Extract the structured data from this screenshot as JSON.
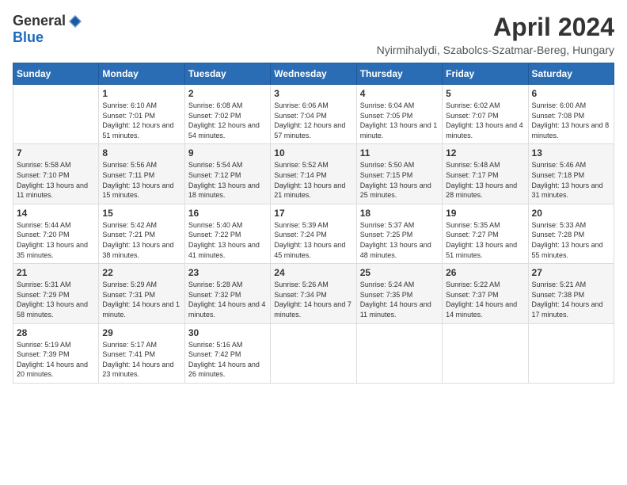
{
  "logo": {
    "general": "General",
    "blue": "Blue"
  },
  "header": {
    "title": "April 2024",
    "location": "Nyirmihalydi, Szabolcs-Szatmar-Bereg, Hungary"
  },
  "weekdays": [
    "Sunday",
    "Monday",
    "Tuesday",
    "Wednesday",
    "Thursday",
    "Friday",
    "Saturday"
  ],
  "weeks": [
    [
      {
        "day": "",
        "sunrise": "",
        "sunset": "",
        "daylight": ""
      },
      {
        "day": "1",
        "sunrise": "Sunrise: 6:10 AM",
        "sunset": "Sunset: 7:01 PM",
        "daylight": "Daylight: 12 hours and 51 minutes."
      },
      {
        "day": "2",
        "sunrise": "Sunrise: 6:08 AM",
        "sunset": "Sunset: 7:02 PM",
        "daylight": "Daylight: 12 hours and 54 minutes."
      },
      {
        "day": "3",
        "sunrise": "Sunrise: 6:06 AM",
        "sunset": "Sunset: 7:04 PM",
        "daylight": "Daylight: 12 hours and 57 minutes."
      },
      {
        "day": "4",
        "sunrise": "Sunrise: 6:04 AM",
        "sunset": "Sunset: 7:05 PM",
        "daylight": "Daylight: 13 hours and 1 minute."
      },
      {
        "day": "5",
        "sunrise": "Sunrise: 6:02 AM",
        "sunset": "Sunset: 7:07 PM",
        "daylight": "Daylight: 13 hours and 4 minutes."
      },
      {
        "day": "6",
        "sunrise": "Sunrise: 6:00 AM",
        "sunset": "Sunset: 7:08 PM",
        "daylight": "Daylight: 13 hours and 8 minutes."
      }
    ],
    [
      {
        "day": "7",
        "sunrise": "Sunrise: 5:58 AM",
        "sunset": "Sunset: 7:10 PM",
        "daylight": "Daylight: 13 hours and 11 minutes."
      },
      {
        "day": "8",
        "sunrise": "Sunrise: 5:56 AM",
        "sunset": "Sunset: 7:11 PM",
        "daylight": "Daylight: 13 hours and 15 minutes."
      },
      {
        "day": "9",
        "sunrise": "Sunrise: 5:54 AM",
        "sunset": "Sunset: 7:12 PM",
        "daylight": "Daylight: 13 hours and 18 minutes."
      },
      {
        "day": "10",
        "sunrise": "Sunrise: 5:52 AM",
        "sunset": "Sunset: 7:14 PM",
        "daylight": "Daylight: 13 hours and 21 minutes."
      },
      {
        "day": "11",
        "sunrise": "Sunrise: 5:50 AM",
        "sunset": "Sunset: 7:15 PM",
        "daylight": "Daylight: 13 hours and 25 minutes."
      },
      {
        "day": "12",
        "sunrise": "Sunrise: 5:48 AM",
        "sunset": "Sunset: 7:17 PM",
        "daylight": "Daylight: 13 hours and 28 minutes."
      },
      {
        "day": "13",
        "sunrise": "Sunrise: 5:46 AM",
        "sunset": "Sunset: 7:18 PM",
        "daylight": "Daylight: 13 hours and 31 minutes."
      }
    ],
    [
      {
        "day": "14",
        "sunrise": "Sunrise: 5:44 AM",
        "sunset": "Sunset: 7:20 PM",
        "daylight": "Daylight: 13 hours and 35 minutes."
      },
      {
        "day": "15",
        "sunrise": "Sunrise: 5:42 AM",
        "sunset": "Sunset: 7:21 PM",
        "daylight": "Daylight: 13 hours and 38 minutes."
      },
      {
        "day": "16",
        "sunrise": "Sunrise: 5:40 AM",
        "sunset": "Sunset: 7:22 PM",
        "daylight": "Daylight: 13 hours and 41 minutes."
      },
      {
        "day": "17",
        "sunrise": "Sunrise: 5:39 AM",
        "sunset": "Sunset: 7:24 PM",
        "daylight": "Daylight: 13 hours and 45 minutes."
      },
      {
        "day": "18",
        "sunrise": "Sunrise: 5:37 AM",
        "sunset": "Sunset: 7:25 PM",
        "daylight": "Daylight: 13 hours and 48 minutes."
      },
      {
        "day": "19",
        "sunrise": "Sunrise: 5:35 AM",
        "sunset": "Sunset: 7:27 PM",
        "daylight": "Daylight: 13 hours and 51 minutes."
      },
      {
        "day": "20",
        "sunrise": "Sunrise: 5:33 AM",
        "sunset": "Sunset: 7:28 PM",
        "daylight": "Daylight: 13 hours and 55 minutes."
      }
    ],
    [
      {
        "day": "21",
        "sunrise": "Sunrise: 5:31 AM",
        "sunset": "Sunset: 7:29 PM",
        "daylight": "Daylight: 13 hours and 58 minutes."
      },
      {
        "day": "22",
        "sunrise": "Sunrise: 5:29 AM",
        "sunset": "Sunset: 7:31 PM",
        "daylight": "Daylight: 14 hours and 1 minute."
      },
      {
        "day": "23",
        "sunrise": "Sunrise: 5:28 AM",
        "sunset": "Sunset: 7:32 PM",
        "daylight": "Daylight: 14 hours and 4 minutes."
      },
      {
        "day": "24",
        "sunrise": "Sunrise: 5:26 AM",
        "sunset": "Sunset: 7:34 PM",
        "daylight": "Daylight: 14 hours and 7 minutes."
      },
      {
        "day": "25",
        "sunrise": "Sunrise: 5:24 AM",
        "sunset": "Sunset: 7:35 PM",
        "daylight": "Daylight: 14 hours and 11 minutes."
      },
      {
        "day": "26",
        "sunrise": "Sunrise: 5:22 AM",
        "sunset": "Sunset: 7:37 PM",
        "daylight": "Daylight: 14 hours and 14 minutes."
      },
      {
        "day": "27",
        "sunrise": "Sunrise: 5:21 AM",
        "sunset": "Sunset: 7:38 PM",
        "daylight": "Daylight: 14 hours and 17 minutes."
      }
    ],
    [
      {
        "day": "28",
        "sunrise": "Sunrise: 5:19 AM",
        "sunset": "Sunset: 7:39 PM",
        "daylight": "Daylight: 14 hours and 20 minutes."
      },
      {
        "day": "29",
        "sunrise": "Sunrise: 5:17 AM",
        "sunset": "Sunset: 7:41 PM",
        "daylight": "Daylight: 14 hours and 23 minutes."
      },
      {
        "day": "30",
        "sunrise": "Sunrise: 5:16 AM",
        "sunset": "Sunset: 7:42 PM",
        "daylight": "Daylight: 14 hours and 26 minutes."
      },
      {
        "day": "",
        "sunrise": "",
        "sunset": "",
        "daylight": ""
      },
      {
        "day": "",
        "sunrise": "",
        "sunset": "",
        "daylight": ""
      },
      {
        "day": "",
        "sunrise": "",
        "sunset": "",
        "daylight": ""
      },
      {
        "day": "",
        "sunrise": "",
        "sunset": "",
        "daylight": ""
      }
    ]
  ]
}
